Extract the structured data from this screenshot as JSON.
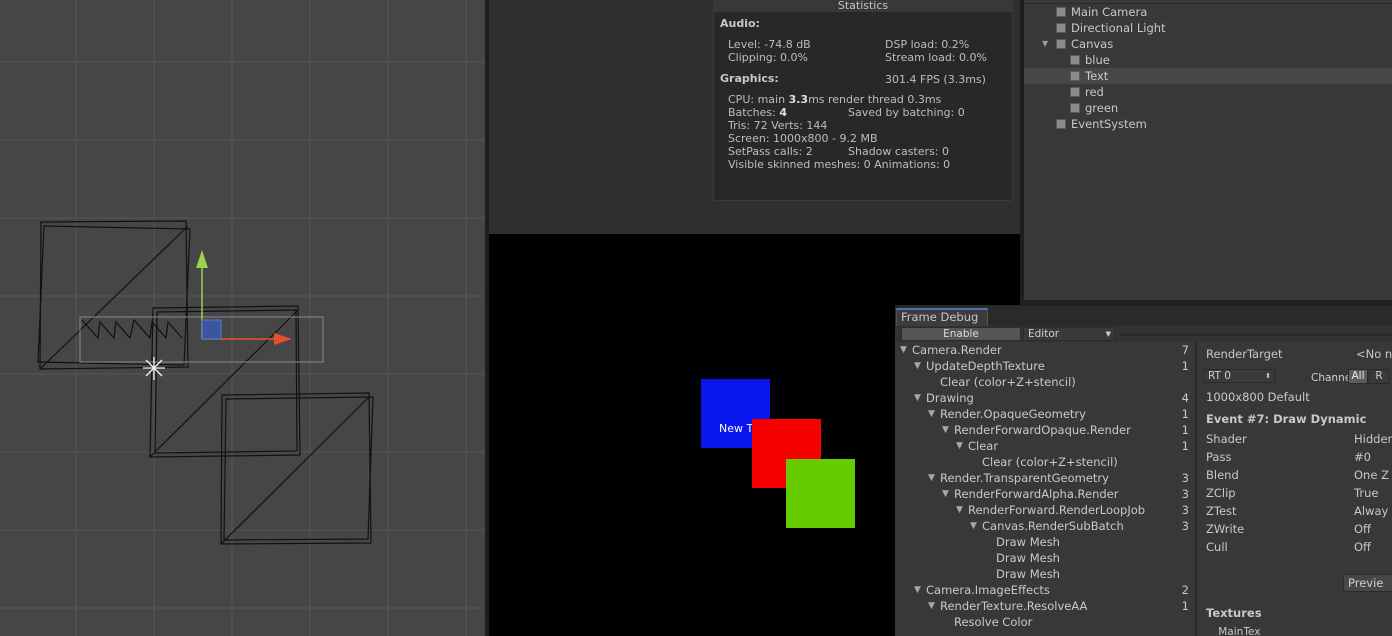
{
  "statistics": {
    "title": "Statistics",
    "audio_header": "Audio:",
    "level": "Level: -74.8 dB",
    "dsp_load": "DSP load: 0.2%",
    "clipping": "Clipping: 0.0%",
    "stream_load": "Stream load: 0.0%",
    "graphics_header": "Graphics:",
    "fps": "301.4 FPS (3.3ms)",
    "cpu_prefix": "CPU: main ",
    "cpu_main": "3.3",
    "cpu_suffix": "ms  render thread 0.3ms",
    "batches_prefix": "Batches: ",
    "batches": "4",
    "saved_by_batching": "Saved by batching: 0",
    "tris_verts": "Tris: 72   Verts: 144",
    "screen": "Screen: 1000x800 - 9.2 MB",
    "setpass": "SetPass calls: 2",
    "shadow_casters": "Shadow casters: 0",
    "skinned": "Visible skinned meshes: 0  Animations: 0"
  },
  "game": {
    "overlay_text": "New Text",
    "cube_colors": {
      "blue": "#0a16ee",
      "red": "#f60000",
      "green": "#66cc00"
    }
  },
  "hierarchy": {
    "items": [
      {
        "label": "Main Camera"
      },
      {
        "label": "Directional Light"
      },
      {
        "label": "Canvas"
      },
      {
        "label": "blue"
      },
      {
        "label": "Text",
        "selected": true
      },
      {
        "label": "red"
      },
      {
        "label": "green"
      },
      {
        "label": "EventSystem"
      }
    ]
  },
  "frame_debug": {
    "tab": "Frame Debug",
    "enable_button": "Enable",
    "target_dropdown": "Editor",
    "tree": [
      {
        "label": "Camera.Render",
        "count": "7"
      },
      {
        "label": "UpdateDepthTexture",
        "count": "1"
      },
      {
        "label": "Clear (color+Z+stencil)",
        "count": ""
      },
      {
        "label": "Drawing",
        "count": "4"
      },
      {
        "label": "Render.OpaqueGeometry",
        "count": "1"
      },
      {
        "label": "RenderForwardOpaque.Render",
        "count": "1"
      },
      {
        "label": "Clear",
        "count": "1"
      },
      {
        "label": "Clear (color+Z+stencil)",
        "count": ""
      },
      {
        "label": "Render.TransparentGeometry",
        "count": "3"
      },
      {
        "label": "RenderForwardAlpha.Render",
        "count": "3"
      },
      {
        "label": "RenderForward.RenderLoopJob",
        "count": "3"
      },
      {
        "label": "Canvas.RenderSubBatch",
        "count": "3"
      },
      {
        "label": "Draw Mesh",
        "count": ""
      },
      {
        "label": "Draw Mesh",
        "count": ""
      },
      {
        "label": "Draw Mesh",
        "count": ""
      },
      {
        "label": "Camera.ImageEffects",
        "count": "2"
      },
      {
        "label": "RenderTexture.ResolveAA",
        "count": "1"
      },
      {
        "label": "Resolve Color",
        "count": ""
      }
    ],
    "details": {
      "render_target_label": "RenderTarget",
      "render_target_value": "<No n",
      "rt_dropdown": "RT 0",
      "channels_label": "Channels",
      "channel_all": "All",
      "channel_r": "R",
      "resolution": "1000x800 Default",
      "event_title": "Event #7: Draw Dynamic",
      "props": [
        {
          "name": "Shader",
          "value": "Hidden"
        },
        {
          "name": "Pass",
          "value": "#0"
        },
        {
          "name": "Blend",
          "value": "One Z"
        },
        {
          "name": "ZClip",
          "value": "True"
        },
        {
          "name": "ZTest",
          "value": "Alway"
        },
        {
          "name": "ZWrite",
          "value": "Off"
        },
        {
          "name": "Cull",
          "value": "Off"
        }
      ],
      "preview_button": "Previe",
      "textures_header": "Textures",
      "maintex": "_MainTex"
    }
  }
}
